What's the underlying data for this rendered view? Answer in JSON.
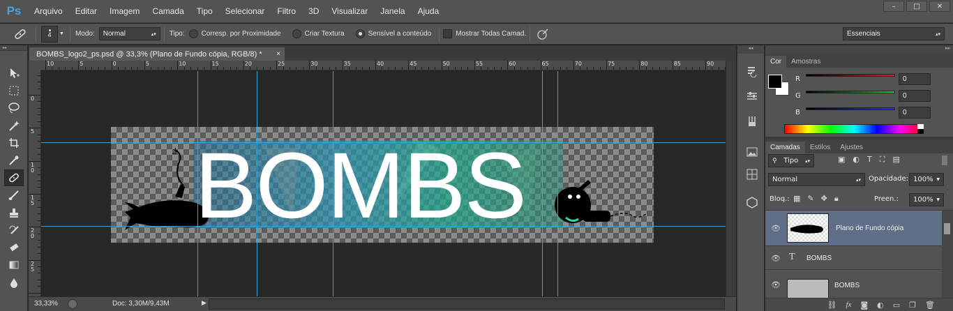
{
  "app": {
    "logo": "Ps",
    "window_controls": [
      "–",
      "□",
      "✕"
    ]
  },
  "menu": [
    "Arquivo",
    "Editar",
    "Imagem",
    "Camada",
    "Tipo",
    "Selecionar",
    "Filtro",
    "3D",
    "Visualizar",
    "Janela",
    "Ajuda"
  ],
  "options": {
    "brush_size": "4",
    "mode_label": "Modo:",
    "mode_value": "Normal",
    "type_label": "Tipo:",
    "radio_proximity": "Corresp. por Proximidade",
    "radio_texture": "Criar Textura",
    "radio_content": "Sensível a conteúdo",
    "sample_all": "Mostrar Todas Camad.",
    "workspace": "Essenciais"
  },
  "document": {
    "tab_title": "BOMBS_logo2_ps.psd @ 33,3% (Plano de Fundo cópia, RGB/8) *",
    "close": "×",
    "canvas_text": "BOMBS",
    "ruler_h": [
      "10",
      "5",
      "0",
      "5",
      "10",
      "15",
      "20",
      "25",
      "30",
      "35",
      "40",
      "45",
      "50",
      "55",
      "60",
      "65",
      "70",
      "75",
      "80",
      "85",
      "90"
    ],
    "ruler_v": [
      "5",
      "0",
      "5",
      "1 0",
      "1 5",
      "2 0",
      "2 5"
    ]
  },
  "status": {
    "zoom": "33,33%",
    "doc_info": "Doc: 3,30M/9,43M"
  },
  "color_panel": {
    "tabs": [
      "Cor",
      "Amostras"
    ],
    "channels": [
      {
        "label": "R",
        "value": "0",
        "color": "#e0202a"
      },
      {
        "label": "G",
        "value": "0",
        "color": "#22c830"
      },
      {
        "label": "B",
        "value": "0",
        "color": "#2838e0"
      }
    ]
  },
  "layers_panel": {
    "tabs": [
      "Camadas",
      "Estilos",
      "Ajustes"
    ],
    "filter_kind": "Tipo",
    "blend_mode": "Normal",
    "opacity_label": "Opacidade:",
    "opacity_value": "100%",
    "lock_label": "Bloq.:",
    "fill_label": "Preen.:",
    "fill_value": "100%",
    "layers": [
      {
        "name": "Plano de Fundo cópia",
        "selected": true
      },
      {
        "name": "BOMBS",
        "kind": "text"
      },
      {
        "name": "BOMBS",
        "kind": "image"
      }
    ]
  },
  "colors": {
    "accent": "#4aa4e4",
    "guide": "#33a6d8",
    "selected_layer": "#5f6f88"
  }
}
